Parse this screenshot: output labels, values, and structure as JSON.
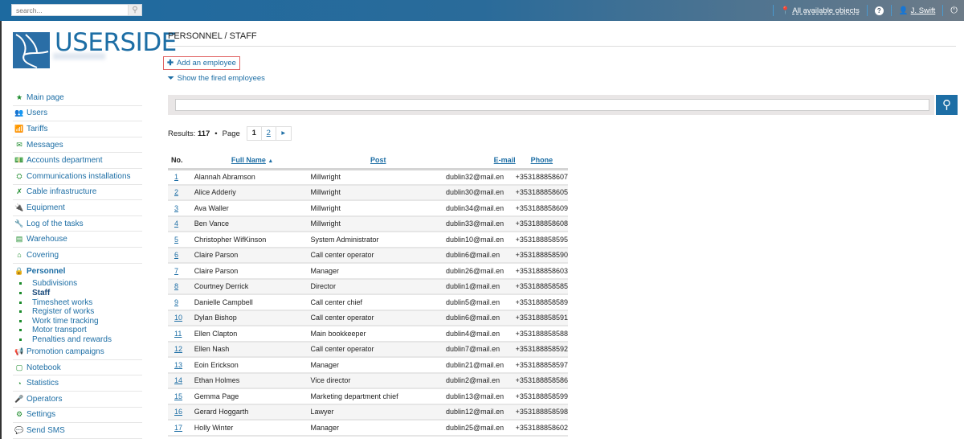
{
  "topbar": {
    "search_placeholder": "search...",
    "objects_label": "All available objects",
    "user_name": "J. Swift"
  },
  "logo": {
    "text": "USERSIDE"
  },
  "sidebar": {
    "items": [
      {
        "label": "Main page",
        "icon": "★"
      },
      {
        "label": "Users",
        "icon": "👥"
      },
      {
        "label": "Tariffs",
        "icon": "📶"
      },
      {
        "label": "Messages",
        "icon": "✉"
      },
      {
        "label": "Accounts department",
        "icon": "💵"
      },
      {
        "label": "Communications installations",
        "icon": "⛭"
      },
      {
        "label": "Cable infrastructure",
        "icon": "✗"
      },
      {
        "label": "Equipment",
        "icon": "🔌"
      },
      {
        "label": "Log of the tasks",
        "icon": "🔧"
      },
      {
        "label": "Warehouse",
        "icon": "▤"
      },
      {
        "label": "Covering",
        "icon": "⌂"
      },
      {
        "label": "Personnel",
        "icon": "🔒"
      }
    ],
    "personnel_sub": [
      "Subdivisions",
      "Staff",
      "Timesheet works",
      "Register of works",
      "Work time tracking",
      "Motor transport",
      "Penalties and rewards"
    ],
    "items_after": [
      {
        "label": "Promotion campaigns",
        "icon": "📢"
      },
      {
        "label": "Notebook",
        "icon": "▢"
      },
      {
        "label": "Statistics",
        "icon": "◔"
      },
      {
        "label": "Operators",
        "icon": "🎤"
      },
      {
        "label": "Settings",
        "icon": "⚙"
      },
      {
        "label": "Send SMS",
        "icon": "💬"
      }
    ]
  },
  "page": {
    "title": "PERSONNEL / STAFF",
    "add_employee": "Add an employee",
    "show_fired": "Show the fired employees",
    "results_label": "Results:",
    "results_count": "117",
    "page_label": "Page",
    "pages": [
      "1",
      "2"
    ],
    "current_page": "1"
  },
  "table": {
    "headers": {
      "no": "No.",
      "name": "Full Name",
      "post": "Post",
      "email": "E-mail",
      "phone": "Phone"
    },
    "sort": "Full Name ascending",
    "rows": [
      [
        "1",
        "Alannah Abramson",
        "Millwright",
        "dublin32@mail.en",
        "+353188858607"
      ],
      [
        "2",
        "Alice Adderiy",
        "Millwright",
        "dublin30@mail.en",
        "+353188858605"
      ],
      [
        "3",
        "Ava Waller",
        "Millwright",
        "dublin34@mail.en",
        "+353188858609"
      ],
      [
        "4",
        "Ben Vance",
        "Millwright",
        "dublin33@mail.en",
        "+353188858608"
      ],
      [
        "5",
        "Christopher WifKinson",
        "System Administrator",
        "dublin10@mail.en",
        "+353188858595"
      ],
      [
        "6",
        "Claire Parson",
        "Call center operator",
        "dublin6@mail.en",
        "+353188858590"
      ],
      [
        "7",
        "Claire Parson",
        "Manager",
        "dublin26@mail.en",
        "+353188858603"
      ],
      [
        "8",
        "Courtney Derrick",
        "Director",
        "dublin1@mail.en",
        "+353188858585"
      ],
      [
        "9",
        "Danielle Campbell",
        "Call center chief",
        "dublin5@mail.en",
        "+353188858589"
      ],
      [
        "10",
        "Dylan Bishop",
        "Call center operator",
        "dublin6@mail.en",
        "+353188858591"
      ],
      [
        "11",
        "Ellen Clapton",
        "Main bookkeeper",
        "dublin4@mail.en",
        "+353188858588"
      ],
      [
        "12",
        "Ellen Nash",
        "Call center operator",
        "dublin7@mail.en",
        "+353188858592"
      ],
      [
        "13",
        "Eoin Erickson",
        "Manager",
        "dublin21@mail.en",
        "+353188858597"
      ],
      [
        "14",
        "Ethan Holmes",
        "Vice director",
        "dublin2@mail.en",
        "+353188858586"
      ],
      [
        "15",
        "Gemma Page",
        "Marketing department chief",
        "dublin13@mail.en",
        "+353188858599"
      ],
      [
        "16",
        "Gerard Hoggarth",
        "Lawyer",
        "dublin12@mail.en",
        "+353188858598"
      ],
      [
        "17",
        "Holly Winter",
        "Manager",
        "dublin25@mail.en",
        "+353188858602"
      ]
    ]
  },
  "colors": {
    "accent": "#1d6ea5",
    "icon_green": "#1a8a2a",
    "highlight_border": "#e06060"
  }
}
